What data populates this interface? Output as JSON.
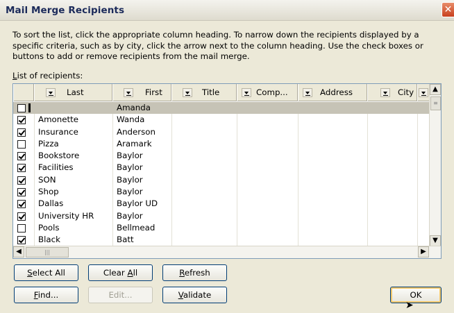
{
  "window": {
    "title": "Mail Merge Recipients",
    "close_glyph": "✕"
  },
  "instructions": "To sort the list, click the appropriate column heading.  To narrow down the recipients displayed by a specific criteria, such as by city, click the arrow next to the column heading.  Use the check boxes or buttons to add or remove recipients from the mail merge.",
  "list_label_prefix": "L",
  "list_label_rest": "ist of recipients:",
  "columns": [
    "Last",
    "First",
    "Title",
    "Comp...",
    "Address",
    "City"
  ],
  "rows": [
    {
      "checked": false,
      "last": "",
      "first": "Amanda",
      "selected": true
    },
    {
      "checked": true,
      "last": "Amonette",
      "first": "Wanda"
    },
    {
      "checked": true,
      "last": "Insurance",
      "first": "Anderson"
    },
    {
      "checked": false,
      "last": "Pizza",
      "first": "Aramark"
    },
    {
      "checked": true,
      "last": "Bookstore",
      "first": "Baylor"
    },
    {
      "checked": true,
      "last": "Facilities",
      "first": "Baylor"
    },
    {
      "checked": true,
      "last": "SON",
      "first": "Baylor"
    },
    {
      "checked": true,
      "last": "Shop",
      "first": "Baylor"
    },
    {
      "checked": true,
      "last": "Dallas",
      "first": "Baylor UD"
    },
    {
      "checked": true,
      "last": "University HR",
      "first": "Baylor"
    },
    {
      "checked": false,
      "last": "Pools",
      "first": "Bellmead"
    },
    {
      "checked": true,
      "last": "Black",
      "first": "Batt"
    }
  ],
  "buttons": {
    "select_all": {
      "u": "S",
      "rest": "elect All"
    },
    "clear_all": {
      "pre": "Clear ",
      "u": "A",
      "rest": "ll"
    },
    "refresh": {
      "u": "R",
      "rest": "efresh"
    },
    "find": {
      "u": "F",
      "rest": "ind..."
    },
    "edit": "Edit...",
    "validate": {
      "u": "V",
      "rest": "alidate"
    },
    "ok": "OK"
  }
}
